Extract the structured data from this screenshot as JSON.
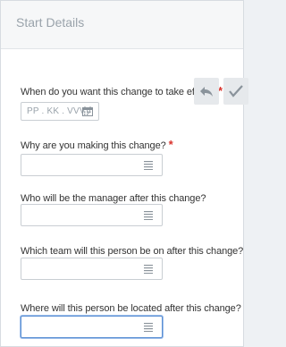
{
  "header": {
    "title": "Start Details"
  },
  "fields": [
    {
      "label": "When do you want this change to take effect?",
      "required": "*",
      "placeholder": "PP . KK . VVVV"
    },
    {
      "label": "Why are you making this change?",
      "required": "*"
    },
    {
      "label": "Who will be the manager after this change?"
    },
    {
      "label": "Which team will this person be on after this change?"
    },
    {
      "label": "Where will this person be located after this change?",
      "required": "*"
    }
  ],
  "actions": {
    "undo_icon": "undo-arrow-icon",
    "confirm_icon": "checkmark-icon"
  },
  "colors": {
    "required": "#d9312b",
    "focus_border": "#5b8fd3",
    "muted_text": "#9aa3ab"
  }
}
